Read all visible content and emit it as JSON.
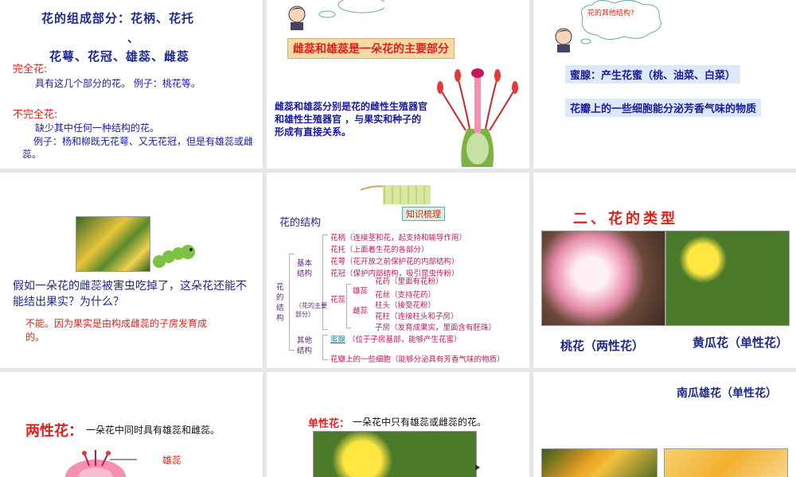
{
  "s1": {
    "heading1": "花的组成部分：花柄、花托",
    "heading_sep": "、",
    "heading2": "花萼、花冠、雄蕊、雌蕊",
    "complete_label": "完全花:",
    "complete_text": "具有这几个部分的花。 例子：桃花等。",
    "incomplete_label": "不完全花:",
    "incomplete_text": "缺少其中任何一种结构的花。",
    "incomplete_example": "例子：杨和柳既无花萼、又无花冠，但是有雄蕊或雌蕊。"
  },
  "s2": {
    "banner": "雌蕊和雄蕊是一朵花的主要部分",
    "body": "雌蕊和雄蕊分别是花的雌性生殖器官和雄性生殖器官 ，与果实和种子的形成有直接关系。"
  },
  "s3": {
    "bubble": "花的其他结构?",
    "line1": "蜜腺：产生花蜜（桃、油菜、白菜）",
    "line2": "花瓣上的一些细胞能分泌芳香气味的物质"
  },
  "s4": {
    "question": "假如一朵花的雌蕊被害虫吃掉了，这朵花还能不能结出果实？为什么？",
    "answer": "不能。因为果实是由构成雌蕊的子房发育成的。"
  },
  "s5": {
    "tag": "知识梳理",
    "title": "花的结构",
    "root": "花的结构",
    "basic": "基本结构",
    "main_note": "（花的主要部分）",
    "other": "其他结构",
    "items": [
      "花柄（连接茎和花，起支持和输导作用）",
      "花托（上面着生花的各部分）",
      "花萼（花开放之前保护花的内部结构）",
      "花冠（保护内部结构，吸引昆虫传粉）"
    ],
    "stamen_group": "花蕊",
    "stamen": "雄蕊",
    "pistil": "雌蕊",
    "stamen_items": [
      "花药（里面有花粉）",
      "花丝（支持花药）"
    ],
    "pistil_items": [
      "柱头（接受花粉）",
      "花柱（连接柱头和子房）",
      "子房（发育成果实，里面含有胚珠）"
    ],
    "nectary": "蜜腺",
    "nectary_text": "（位于子房基部，能够产生花蜜）",
    "petal_cells": "花瓣上的一些细胞（能够分泌具有芳香气味的物质）"
  },
  "s6": {
    "title": "二、花的类型",
    "caption1": "桃花（两性花）",
    "caption2": "黄瓜花（单性花）"
  },
  "s7": {
    "label": "两性花：",
    "text": "一朵花中同时具有雄蕊和雌蕊。",
    "annot": "雄蕊"
  },
  "s8": {
    "label": "单性花：",
    "text": "一朵花中只有雄蕊或雌蕊的花。"
  },
  "s9": {
    "caption": "南瓜雄花（单性花）"
  },
  "colors": {
    "red": "#e0211a",
    "blue": "#1a1aa0",
    "banner": "#f5d9a6"
  }
}
